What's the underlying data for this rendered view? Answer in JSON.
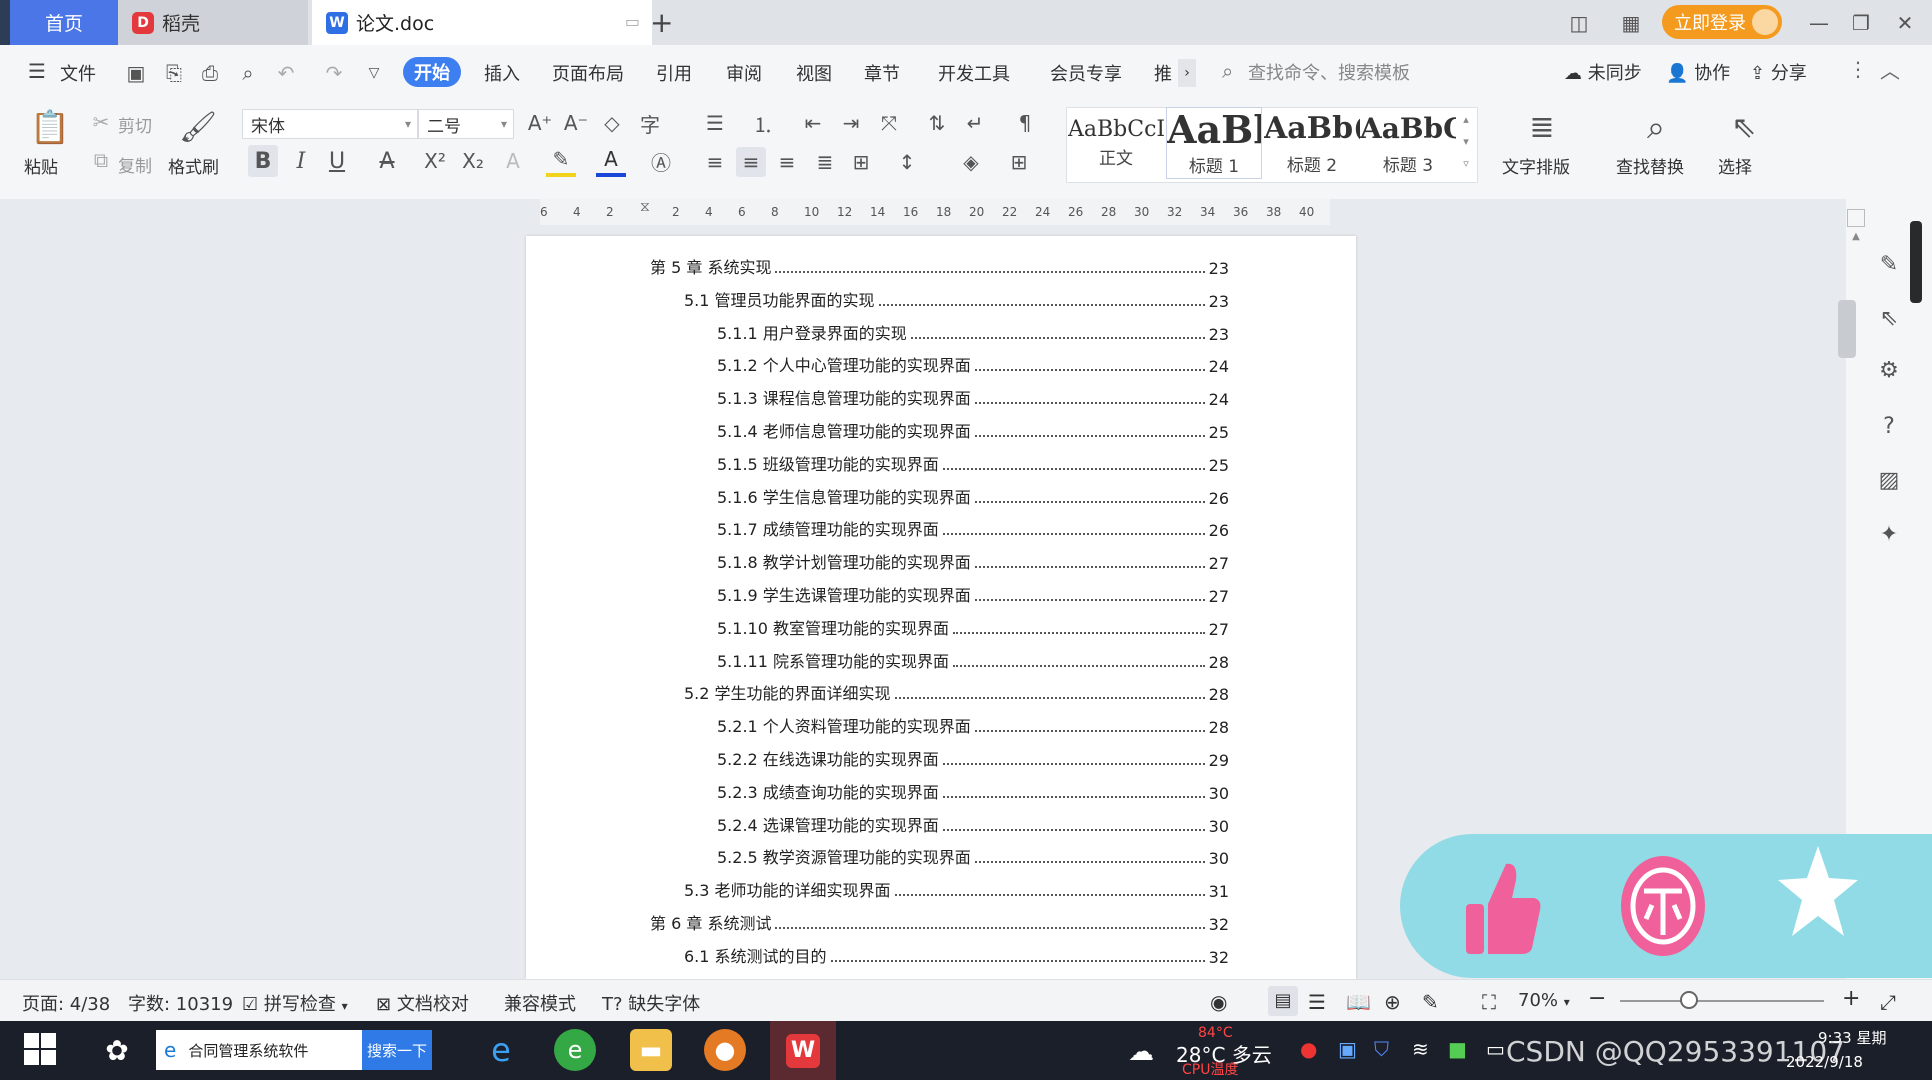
{
  "tabs": {
    "home": "首页",
    "daoke": "稻壳",
    "doc": "论文.doc",
    "add": "+"
  },
  "login": "立即登录",
  "menu": {
    "file": "文件",
    "start": "开始",
    "insert": "插入",
    "layout": "页面布局",
    "reference": "引用",
    "review": "审阅",
    "view": "视图",
    "chapter": "章节",
    "devtools": "开发工具",
    "member": "会员专享",
    "more": "推",
    "search_placeholder": "查找命令、搜索模板",
    "unsync": "未同步",
    "collab": "协作",
    "share": "分享"
  },
  "ribbon": {
    "paste": "粘贴",
    "cut": "剪切",
    "copy": "复制",
    "format_painter": "格式刷",
    "font": "宋体",
    "size": "二号",
    "styles": [
      {
        "preview": "AaBbCcI",
        "name": "正文"
      },
      {
        "preview": "AaBl",
        "name": "标题 1"
      },
      {
        "preview": "AaBb(",
        "name": "标题 2"
      },
      {
        "preview": "AaBbC",
        "name": "标题 3"
      }
    ],
    "text_layout": "文字排版",
    "find_replace": "查找替换",
    "select": "选择"
  },
  "ruler_ticks": [
    "6",
    "4",
    "2",
    "",
    "2",
    "4",
    "6",
    "8",
    "10",
    "12",
    "14",
    "16",
    "18",
    "20",
    "22",
    "24",
    "26",
    "28",
    "30",
    "32",
    "34",
    "36",
    "38",
    "40"
  ],
  "toc": [
    {
      "text": "第 5 章  系统实现",
      "page": "23",
      "level": 0
    },
    {
      "text": "5.1 管理员功能界面的实现",
      "page": "23",
      "level": 1
    },
    {
      "text": "5.1.1 用户登录界面的实现",
      "page": "23",
      "level": 2
    },
    {
      "text": "5.1.2 个人中心管理功能的实现界面",
      "page": "24",
      "level": 2
    },
    {
      "text": "5.1.3 课程信息管理功能的实现界面",
      "page": "24",
      "level": 2
    },
    {
      "text": "5.1.4 老师信息管理功能的实现界面",
      "page": "25",
      "level": 2
    },
    {
      "text": "5.1.5 班级管理功能的实现界面",
      "page": "25",
      "level": 2
    },
    {
      "text": "5.1.6 学生信息管理功能的实现界面",
      "page": "26",
      "level": 2
    },
    {
      "text": "5.1.7 成绩管理功能的实现界面",
      "page": "26",
      "level": 2
    },
    {
      "text": "5.1.8 教学计划管理功能的实现界面",
      "page": "27",
      "level": 2
    },
    {
      "text": "5.1.9 学生选课管理功能的实现界面",
      "page": "27",
      "level": 2
    },
    {
      "text": "5.1.10 教室管理功能的实现界面",
      "page": "27",
      "level": 2
    },
    {
      "text": "5.1.11 院系管理功能的实现界面",
      "page": "28",
      "level": 2
    },
    {
      "text": "5.2 学生功能的界面详细实现",
      "page": "28",
      "level": 1
    },
    {
      "text": "5.2.1 个人资料管理功能的实现界面",
      "page": "28",
      "level": 2
    },
    {
      "text": "5.2.2 在线选课功能的实现界面",
      "page": "29",
      "level": 2
    },
    {
      "text": "5.2.3 成绩查询功能的实现界面",
      "page": "30",
      "level": 2
    },
    {
      "text": "5.2.4 选课管理功能的实现界面",
      "page": "30",
      "level": 2
    },
    {
      "text": "5.2.5 教学资源管理功能的实现界面",
      "page": "30",
      "level": 2
    },
    {
      "text": "5.3 老师功能的详细实现界面",
      "page": "31",
      "level": 1
    },
    {
      "text": "第 6 章  系统测试",
      "page": "32",
      "level": 0
    },
    {
      "text": "6.1 系统测试的目的",
      "page": "32",
      "level": 1
    }
  ],
  "status": {
    "page": "页面: 4/38",
    "words": "字数: 10319",
    "spell": "拼写检查",
    "proof": "文档校对",
    "compat": "兼容模式",
    "missing_font": "缺失字体",
    "zoom": "70%"
  },
  "taskbar": {
    "search_app": "合同管理系统软件",
    "search_btn": "搜索一下",
    "weather": "28°C 多云",
    "cpu": "84°C",
    "cpu_label": "CPU温度",
    "watermark": "CSDN @QQ2953391107",
    "time": "9:33 星期",
    "date": "2022/9/18"
  },
  "colors": {
    "accent": "#3d7ef1",
    "login": "#f39a1f",
    "overlay": "#90dbe6",
    "thumb": "#f0609a"
  }
}
